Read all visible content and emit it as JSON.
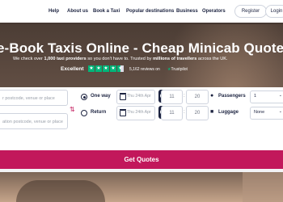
{
  "nav": {
    "items": [
      "Help",
      "About us",
      "Book a Taxi",
      "Popular destinations",
      "Business",
      "Operators"
    ],
    "register_label": "Register",
    "login_label": "Login"
  },
  "hero": {
    "headline": "e-Book Taxis Online - Cheap Minicab Quotes",
    "subline_start": "We check over ",
    "subline_bold1": "1,000 taxi providers",
    "subline_mid": " so you don't have to. Trusted by ",
    "subline_bold2": "millions of travellers",
    "subline_end": " across the UK.",
    "rating_label": "Excellent",
    "reviews_text": "5,162 reviews on",
    "trustpilot_label": "Trustpilot",
    "stars": 4.5
  },
  "form": {
    "pickup_placeholder": "r postcode, venue or place",
    "dropoff_placeholder": "ation postcode, venue or place",
    "one_way_label": "One way",
    "return_label": "Return",
    "one_way_date": "Thu 24th Apr",
    "return_date": "Thu 24th Apr",
    "one_way_hour": "11",
    "one_way_minute": "20",
    "return_hour": "11",
    "return_minute": "20",
    "passengers_label": "Passengers",
    "passengers_value": "1",
    "luggage_label": "Luggage",
    "luggage_value": "None",
    "submit_label": "Get Quotes"
  },
  "colors": {
    "brand_navy": "#1c2340",
    "cta_pink": "#c2185b",
    "trustpilot_green": "#00b67a"
  }
}
